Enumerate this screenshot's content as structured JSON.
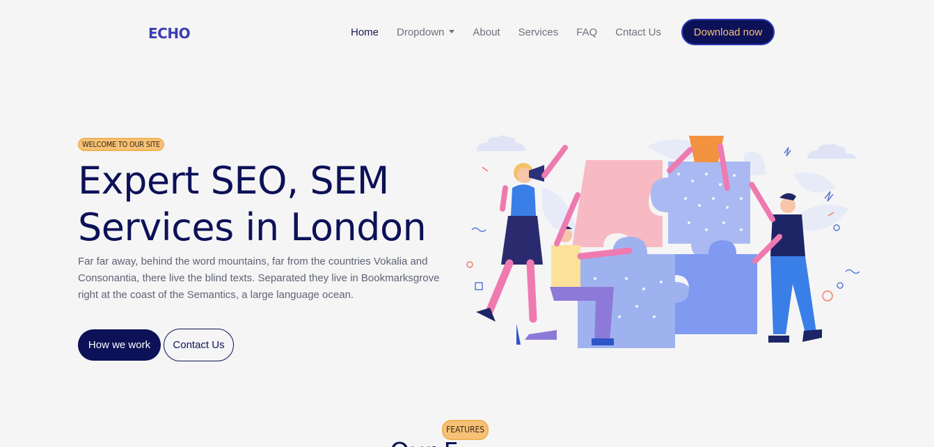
{
  "nav": {
    "logo": "ECHO",
    "items": [
      {
        "label": "Home",
        "active": true
      },
      {
        "label": "Dropdown",
        "has_caret": true
      },
      {
        "label": "About"
      },
      {
        "label": "Services"
      },
      {
        "label": "FAQ"
      },
      {
        "label": "Cntact Us"
      }
    ],
    "cta": "Download now"
  },
  "hero": {
    "badge": "WELCOME TO OUR SITE",
    "title_line1": "Expert SEO, SEM",
    "title_line2": "Services in London",
    "text": "Far far away, behind the word mountains, far from the countries Vokalia and Consonantia, there live the blind texts. Separated they live in Bookmarksgrove right at the coast of the Semantics, a large language ocean.",
    "primary_button": "How we work",
    "secondary_button": "Contact Us"
  },
  "features": {
    "badge": "FEATURES",
    "title_partial": "Our F"
  },
  "colors": {
    "navy": "#0c1158",
    "accent": "#f6c177",
    "logo": "#3b3db3",
    "background": "#f5f5f5"
  }
}
